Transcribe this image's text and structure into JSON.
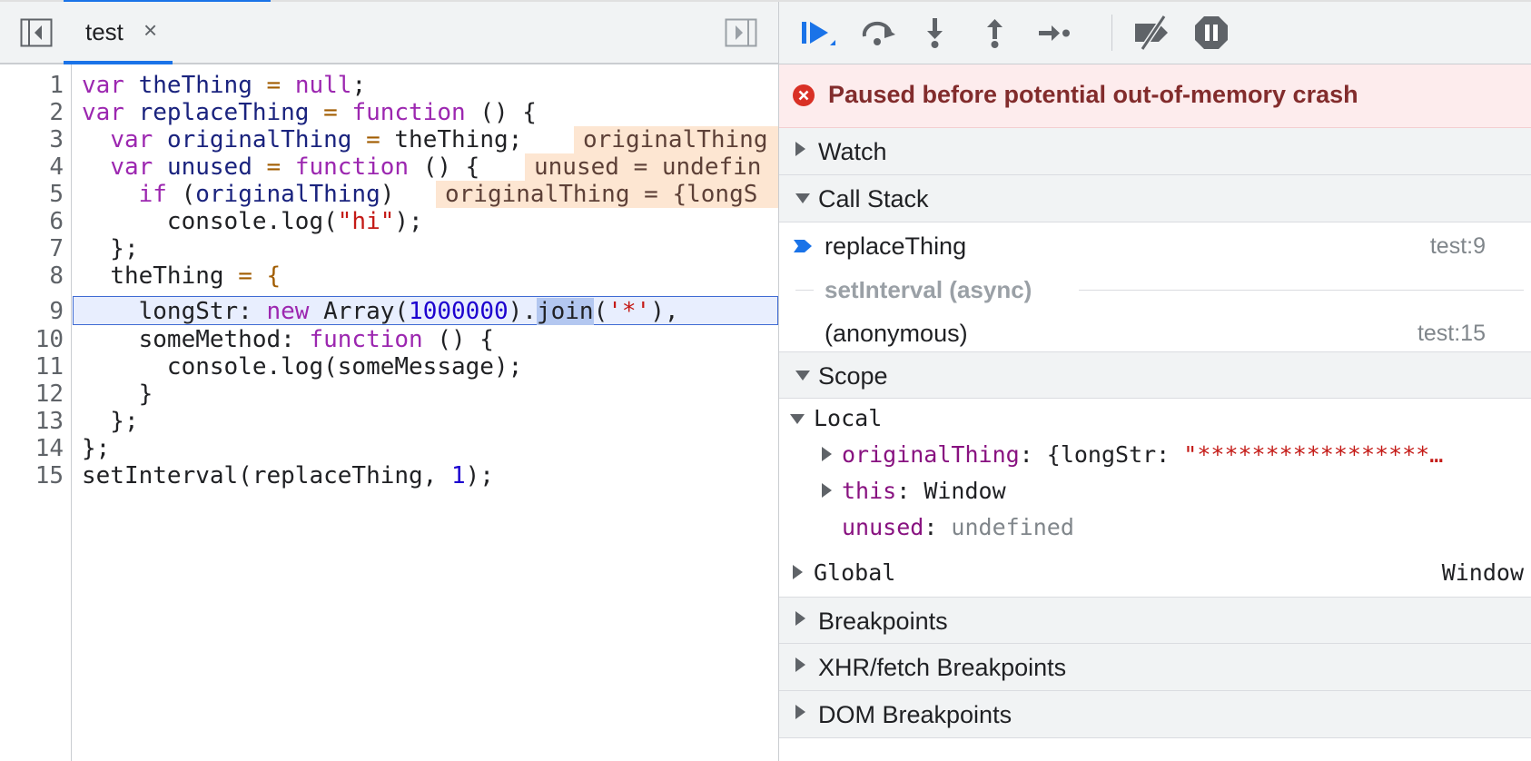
{
  "editor": {
    "tab_label": "test",
    "tab_close": "×",
    "lines": [
      {
        "n": "1"
      },
      {
        "n": "2"
      },
      {
        "n": "3"
      },
      {
        "n": "4"
      },
      {
        "n": "5"
      },
      {
        "n": "6"
      },
      {
        "n": "7"
      },
      {
        "n": "8"
      },
      {
        "n": "9"
      },
      {
        "n": "10"
      },
      {
        "n": "11"
      },
      {
        "n": "12"
      },
      {
        "n": "13"
      },
      {
        "n": "14"
      },
      {
        "n": "15"
      }
    ],
    "code": {
      "l1": [
        "var",
        " ",
        "theThing",
        " = ",
        "null",
        ";"
      ],
      "l2": [
        "var",
        " ",
        "replaceThing",
        " = ",
        "function",
        " () {"
      ],
      "l3": [
        "  ",
        "var",
        " ",
        "originalThing",
        " = ",
        "theThing;"
      ],
      "l4": [
        "  ",
        "var",
        " ",
        "unused",
        " = ",
        "function",
        " () {"
      ],
      "l5": [
        "    ",
        "if",
        " (",
        "originalThing",
        ")"
      ],
      "l6": [
        "      console.log(",
        "\"hi\"",
        ");"
      ],
      "l7": [
        "  };"
      ],
      "l8": [
        "  ",
        "theThing",
        " = {"
      ],
      "l9": [
        "    longStr: ",
        "new",
        " Array(",
        "1000000",
        ").",
        "join",
        "(",
        "'*'",
        "),"
      ],
      "l10": [
        "    someMethod: ",
        "function",
        " () {"
      ],
      "l11": [
        "      console.log(someMessage);"
      ],
      "l12": [
        "    }"
      ],
      "l13": [
        "  };"
      ],
      "l14": [
        "};"
      ],
      "l15": [
        "setInterval(replaceThing, ",
        "1",
        ");"
      ]
    },
    "inline_values": {
      "l3": "originalThing",
      "l4": "unused = undefin",
      "l5": "originalThing = {longS"
    },
    "current_line": "9"
  },
  "toolbar": {
    "buttons": [
      "resume-icon",
      "step-over-icon",
      "step-into-icon",
      "step-out-icon",
      "step-icon",
      "deactivate-breakpoints-icon",
      "pause-on-exceptions-icon"
    ]
  },
  "paused": {
    "message": "Paused before potential out-of-memory crash"
  },
  "sections": {
    "watch": "Watch",
    "call_stack": "Call Stack",
    "scope": "Scope",
    "breakpoints": "Breakpoints",
    "xhr": "XHR/fetch Breakpoints",
    "dom": "DOM Breakpoints"
  },
  "call_stack": {
    "frames": [
      {
        "name": "replaceThing",
        "location": "test:9"
      },
      {
        "name": "(anonymous)",
        "location": "test:15"
      }
    ],
    "async_label": "setInterval (async)"
  },
  "scope": {
    "local_label": "Local",
    "entries": [
      {
        "key": "originalThing",
        "value_prefix": ": {longStr: ",
        "value_str": "\"*****************…"
      },
      {
        "key": "this",
        "value_prefix": ": Window"
      },
      {
        "key": "unused",
        "value_prefix": ": ",
        "value_undef": "undefined"
      }
    ],
    "global_label": "Global",
    "global_value": "Window"
  },
  "colors": {
    "accent": "#1a73e8",
    "paused_bg": "#fdeced",
    "paused_text": "#822c2c",
    "current_line_bg": "#e8eefe"
  }
}
